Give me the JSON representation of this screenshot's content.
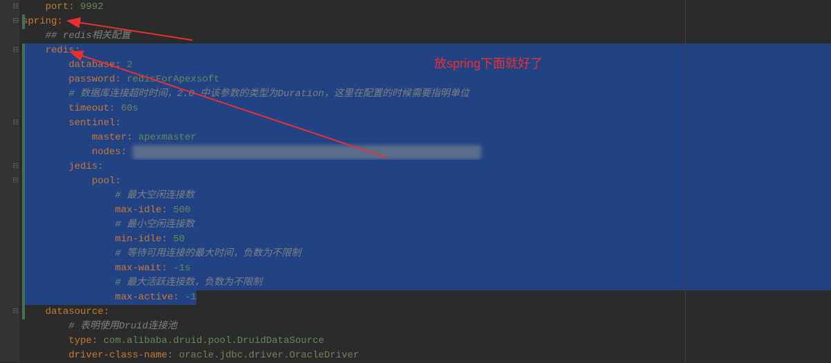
{
  "annotation": "放spring下面就好了",
  "lines": [
    {
      "indent": 2,
      "key": "port",
      "val": "9992",
      "sel": false,
      "fold": "-",
      "bar": ""
    },
    {
      "indent": 0,
      "key": "spring",
      "val": "",
      "sel": false,
      "fold": "-",
      "bar": "green"
    },
    {
      "indent": 2,
      "comment": "## redis相关配置",
      "sel": false,
      "fold": "",
      "bar": ""
    },
    {
      "indent": 2,
      "key": "redis",
      "val": "",
      "sel": true,
      "fold": "-",
      "bar": "green"
    },
    {
      "indent": 4,
      "key": "database",
      "val": "2",
      "sel": true,
      "fold": "",
      "bar": "green"
    },
    {
      "indent": 4,
      "key": "password",
      "val": "redisForApexsoft",
      "sel": true,
      "fold": "",
      "bar": "green"
    },
    {
      "indent": 4,
      "comment": "# 数据库连接超时时间，2.0 中该参数的类型为Duration，这里在配置的时候需要指明单位",
      "sel": true,
      "fold": "",
      "bar": "green"
    },
    {
      "indent": 4,
      "key": "timeout",
      "val": "60s",
      "sel": true,
      "fold": "",
      "bar": "green"
    },
    {
      "indent": 4,
      "key": "sentinel",
      "val": "",
      "sel": true,
      "fold": "-",
      "bar": "green"
    },
    {
      "indent": 6,
      "key": "master",
      "val": "apexmaster",
      "sel": true,
      "fold": "",
      "bar": "green"
    },
    {
      "indent": 6,
      "key": "nodes",
      "val": "",
      "blur": true,
      "sel": true,
      "fold": "",
      "bar": "green"
    },
    {
      "indent": 4,
      "key": "jedis",
      "val": "",
      "sel": true,
      "fold": "-",
      "bar": "green"
    },
    {
      "indent": 6,
      "key": "pool",
      "val": "",
      "sel": true,
      "fold": "-",
      "bar": "green"
    },
    {
      "indent": 8,
      "comment": "# 最大空闲连接数",
      "sel": true,
      "fold": "",
      "bar": "green"
    },
    {
      "indent": 8,
      "key": "max-idle",
      "val": "500",
      "sel": true,
      "fold": "",
      "bar": "green"
    },
    {
      "indent": 8,
      "comment": "# 最小空闲连接数",
      "sel": true,
      "fold": "",
      "bar": "green"
    },
    {
      "indent": 8,
      "key": "min-idle",
      "val": "50",
      "sel": true,
      "fold": "",
      "bar": "green"
    },
    {
      "indent": 8,
      "comment": "# 等待可用连接的最大时间，负数为不限制",
      "sel": true,
      "fold": "",
      "bar": "green"
    },
    {
      "indent": 8,
      "key": "max-wait",
      "val": "-1s",
      "sel": true,
      "fold": "",
      "bar": "green"
    },
    {
      "indent": 8,
      "comment": "# 最大活跃连接数，负数为不限制",
      "sel": true,
      "fold": "",
      "bar": "green"
    },
    {
      "indent": 8,
      "key": "max-active",
      "val": "-1",
      "sel": true,
      "fold": "",
      "bar": "green",
      "partial": true
    },
    {
      "indent": 2,
      "key": "datasource",
      "val": "",
      "sel": false,
      "fold": "-",
      "bar": "green"
    },
    {
      "indent": 4,
      "comment": "# 表明使用Druid连接池",
      "sel": false,
      "fold": "",
      "bar": ""
    },
    {
      "indent": 4,
      "key": "type",
      "val": "com.alibaba.druid.pool.DruidDataSource",
      "sel": false,
      "fold": "",
      "bar": ""
    },
    {
      "indent": 4,
      "key": "driver-class-name",
      "val": "oracle.jdbc.driver.OracleDriver",
      "sel": false,
      "fold": "",
      "bar": ""
    }
  ]
}
